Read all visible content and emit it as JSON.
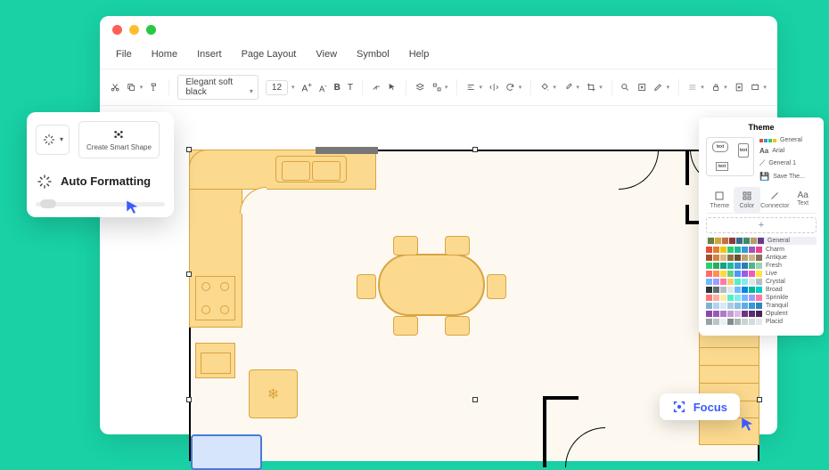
{
  "menu": {
    "file": "File",
    "home": "Home",
    "insert": "Insert",
    "page": "Page Layout",
    "view": "View",
    "symbol": "Symbol",
    "help": "Help"
  },
  "toolbar": {
    "font": "Elegant soft black",
    "size": "12",
    "bold": "B",
    "underline": "A",
    "text": "T"
  },
  "popout": {
    "smart": "Create Smart Shape",
    "auto": "Auto Formatting"
  },
  "focus": {
    "label": "Focus"
  },
  "theme": {
    "title": "Theme",
    "list": {
      "general": "General",
      "arial": "Arial",
      "general1": "General 1",
      "save": "Save The..."
    },
    "tabs": {
      "theme": "Theme",
      "color": "Color",
      "connector": "Connector",
      "text": "Text"
    },
    "add": "+",
    "palettes": [
      "General",
      "Charm",
      "Antique",
      "Fresh",
      "Live",
      "Crystal",
      "Broad",
      "Sprinkle",
      "Tranquil",
      "Opulent",
      "Placid"
    ],
    "prev": {
      "a": "text",
      "b": "text",
      "c": "text"
    }
  },
  "tabicons": {
    "theme": "Aa",
    "text": "Aa"
  }
}
